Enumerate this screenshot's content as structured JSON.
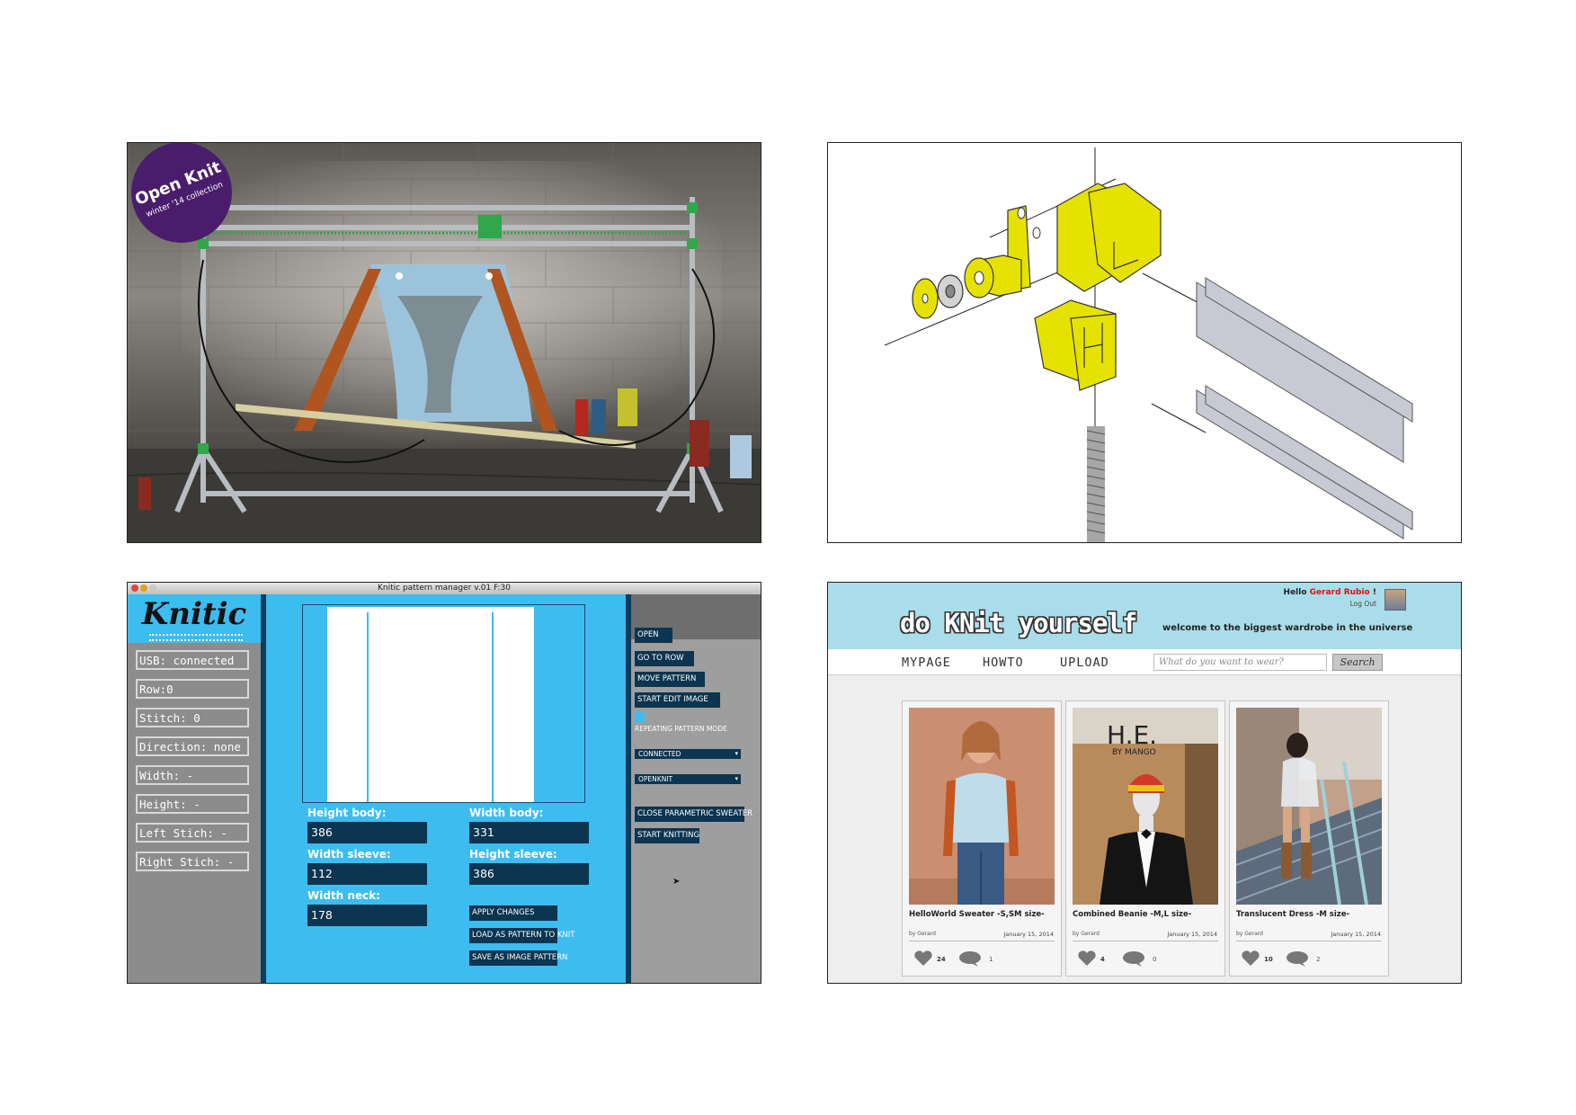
{
  "photo_panel": {
    "badge_title": "Open Knit",
    "badge_subtitle": "winter '14 collection"
  },
  "knitic": {
    "window_title": "Knitic pattern manager v.01 F:30",
    "logo": "Knitic",
    "status": [
      "USB: connected",
      "Row:0",
      "Stitch: 0",
      "Direction: none",
      "Width: -",
      "Height: -",
      "Left Stich: -",
      "Right Stich: -"
    ],
    "fields": {
      "height_body_label": "Height body:",
      "height_body_value": "386",
      "width_body_label": "Width body:",
      "width_body_value": "331",
      "width_sleeve_label": "Width sleeve:",
      "width_sleeve_value": "112",
      "height_sleeve_label": "Height sleeve:",
      "height_sleeve_value": "386",
      "width_neck_label": "Width neck:",
      "width_neck_value": "178"
    },
    "center_buttons": [
      "APPLY CHANGES",
      "LOAD AS PATTERN TO KNIT",
      "SAVE AS IMAGE PATTERN"
    ],
    "right_buttons": [
      "OPEN",
      "GO TO ROW",
      "MOVE PATTERN",
      "START EDIT IMAGE"
    ],
    "repeating_mode_label": "REPEATING PATTERN MODE",
    "selects": [
      "CONNECTED",
      "OPENKNIT"
    ],
    "bottom_buttons": [
      "CLOSE PARAMETRIC SWEATER",
      "START KNITTING"
    ],
    "accent_color": "#3dbcf0",
    "dark_color": "#0b3550"
  },
  "doknit": {
    "logo": "do KNit yourself",
    "tagline": "welcome to the biggest wardrobe in the universe",
    "hello_prefix": "Hello",
    "user_name": "Gerard Rubio",
    "hello_suffix": "!",
    "logout": "Log Out",
    "nav": [
      "MYPAGE",
      "HOWTO",
      "UPLOAD"
    ],
    "search_placeholder": "What do you want to wear?",
    "search_button": "Search",
    "cards": [
      {
        "title": "HelloWorld Sweater -S,SM size-",
        "by": "by Gerard",
        "date": "January 15, 2014",
        "likes": "24",
        "comments": "1"
      },
      {
        "title": "Combined Beanie -M,L size-",
        "by": "by Gerard",
        "date": "January 15, 2014",
        "likes": "4",
        "comments": "0"
      },
      {
        "title": "Translucent Dress -M size-",
        "by": "by Gerard",
        "date": "January 15, 2014",
        "likes": "10",
        "comments": "2"
      }
    ],
    "mannequin_sign": "H.E.",
    "mannequin_sign_sub": "BY MANGO"
  }
}
